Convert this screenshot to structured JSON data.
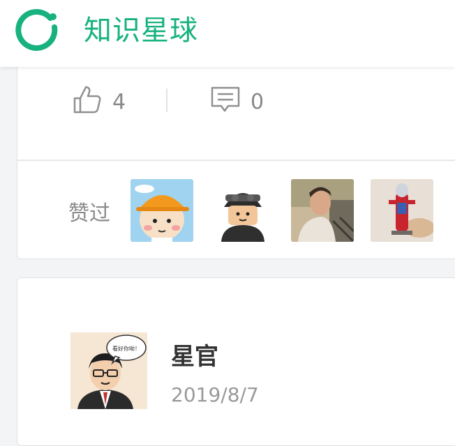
{
  "header": {
    "brand_name": "知识星球",
    "logo_icon": "ring-logo-icon",
    "brand_color": "#17b27f"
  },
  "actions": {
    "like_icon": "thumbs-up-icon",
    "like_count": "4",
    "comment_icon": "comment-icon",
    "comment_count": "0"
  },
  "likes": {
    "label": "赞过",
    "avatars": [
      "avatar-cartoon-girl",
      "avatar-soldier",
      "avatar-man-photo",
      "avatar-figure-photo"
    ]
  },
  "post": {
    "author_name": "星官",
    "date": "2019/8/7",
    "avatar_bubble_text": "看好你呦！"
  }
}
